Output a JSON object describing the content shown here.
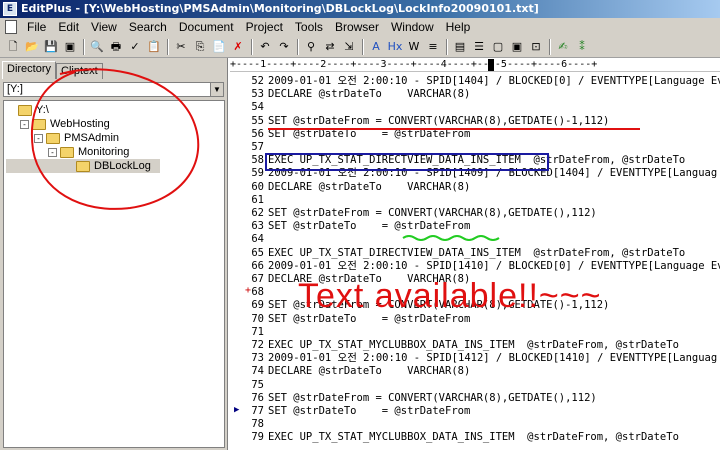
{
  "titlebar": {
    "title": "EditPlus - [Y:\\WebHosting\\PMSAdmin\\Monitoring\\DBLockLog\\LockInfo20090101.txt]"
  },
  "menu": [
    "File",
    "Edit",
    "View",
    "Search",
    "Document",
    "Project",
    "Tools",
    "Browser",
    "Window",
    "Help"
  ],
  "toolbar_icons": [
    "new-file-icon",
    "open-folder-icon",
    "save-icon",
    "save-all-icon",
    "print-preview-icon",
    "print-icon",
    "spell-check-icon",
    "find-icon",
    "cut-icon",
    "copy-icon",
    "paste-icon",
    "delete-icon",
    "undo-icon",
    "redo-icon",
    "find-replace-icon",
    "replace-icon",
    "goto-icon",
    "font-icon",
    "hex-icon",
    "word-wrap-icon",
    "line-number-icon",
    "ruler-icon",
    "directory-window-icon",
    "output-window-icon",
    "cliptext-window-icon",
    "fullscreen-icon",
    "user-tool-icon",
    "run-icon"
  ],
  "toolbar_glyphs": [
    "🗋",
    "📂",
    "💾",
    "▣",
    "🔍",
    "🖶",
    "✓",
    "📋",
    "✂",
    "⎘",
    "📄",
    "✗",
    "↶",
    "↷",
    "⚲",
    "⇄",
    "⇲",
    "A",
    "Hx",
    "W",
    "≡",
    "▤",
    "☰",
    "▢",
    "▣",
    "⊡",
    "✍",
    "⁑",
    "⁞"
  ],
  "left": {
    "tabs": [
      "Directory",
      "Cliptext"
    ],
    "drive": "[Y:]",
    "tree": [
      {
        "label": "Y:\\",
        "depth": 0,
        "expander": ""
      },
      {
        "label": "WebHosting",
        "depth": 1,
        "expander": "-"
      },
      {
        "label": "PMSAdmin",
        "depth": 2,
        "expander": "-"
      },
      {
        "label": "Monitoring",
        "depth": 3,
        "expander": "-"
      },
      {
        "label": "DBLockLog",
        "depth": 4,
        "expander": "",
        "selected": true
      }
    ]
  },
  "ruler": "+----1----+----2----+----3----+----4----+----5----+----6----+",
  "code_lines": [
    {
      "n": "52",
      "t": "2009-01-01 오전 2:00:10 - SPID[1404] / BLOCKED[0] / EVENTTYPE[Language Even"
    },
    {
      "n": "53",
      "t": "DECLARE @strDateTo    VARCHAR(8)"
    },
    {
      "n": "54",
      "t": ""
    },
    {
      "n": "55",
      "t": "SET @strDateFrom = CONVERT(VARCHAR(8),GETDATE()-1,112)"
    },
    {
      "n": "56",
      "t": "SET @strDateTo    = @strDateFrom"
    },
    {
      "n": "57",
      "t": ""
    },
    {
      "n": "58",
      "t": "EXEC UP_TX_STAT_DIRECTVIEW_DATA_INS_ITEM  @strDateFrom, @strDateTo"
    },
    {
      "n": "59",
      "t": "2009-01-01 오전 2:00:10 - SPID[1409] / BLOCKED[1404] / EVENTTYPE[Languag"
    },
    {
      "n": "60",
      "t": "DECLARE @strDateTo    VARCHAR(8)"
    },
    {
      "n": "61",
      "t": ""
    },
    {
      "n": "62",
      "t": "SET @strDateFrom = CONVERT(VARCHAR(8),GETDATE(),112)"
    },
    {
      "n": "63",
      "t": "SET @strDateTo    = @strDateFrom"
    },
    {
      "n": "64",
      "t": ""
    },
    {
      "n": "65",
      "t": "EXEC UP_TX_STAT_DIRECTVIEW_DATA_INS_ITEM  @strDateFrom, @strDateTo"
    },
    {
      "n": "66",
      "t": "2009-01-01 오전 2:00:10 - SPID[1410] / BLOCKED[0] / EVENTTYPE[Language Eve"
    },
    {
      "n": "67",
      "t": "DECLARE @strDateTo    VARCHAR(8)"
    },
    {
      "n": "68",
      "t": ""
    },
    {
      "n": "69",
      "t": "SET @strDateFrom = CONVERT(VARCHAR(8),GETDATE()-1,112)"
    },
    {
      "n": "70",
      "t": "SET @strDateTo    = @strDateFrom"
    },
    {
      "n": "71",
      "t": ""
    },
    {
      "n": "72",
      "t": "EXEC UP_TX_STAT_MYCLUBBOX_DATA_INS_ITEM  @strDateFrom, @strDateTo"
    },
    {
      "n": "73",
      "t": "2009-01-01 오전 2:00:10 - SPID[1412] / BLOCKED[1410] / EVENTTYPE[Languag"
    },
    {
      "n": "74",
      "t": "DECLARE @strDateTo    VARCHAR(8)"
    },
    {
      "n": "75",
      "t": ""
    },
    {
      "n": "76",
      "t": "SET @strDateFrom = CONVERT(VARCHAR(8),GETDATE(),112)"
    },
    {
      "n": "77",
      "t": "SET @strDateTo    = @strDateFrom"
    },
    {
      "n": "78",
      "t": ""
    },
    {
      "n": "79",
      "t": "EXEC UP_TX_STAT_MYCLUBBOX_DATA_INS_ITEM  @strDateFrom, @strDateTo"
    }
  ],
  "annotation": {
    "text": "Text available!!~~~",
    "color": "#e01010"
  },
  "colors": {
    "accent": "#0a246a",
    "annotation_red": "#e01010",
    "highlight_blue": "#1a1aa0",
    "underline_green": "#22cc22"
  }
}
